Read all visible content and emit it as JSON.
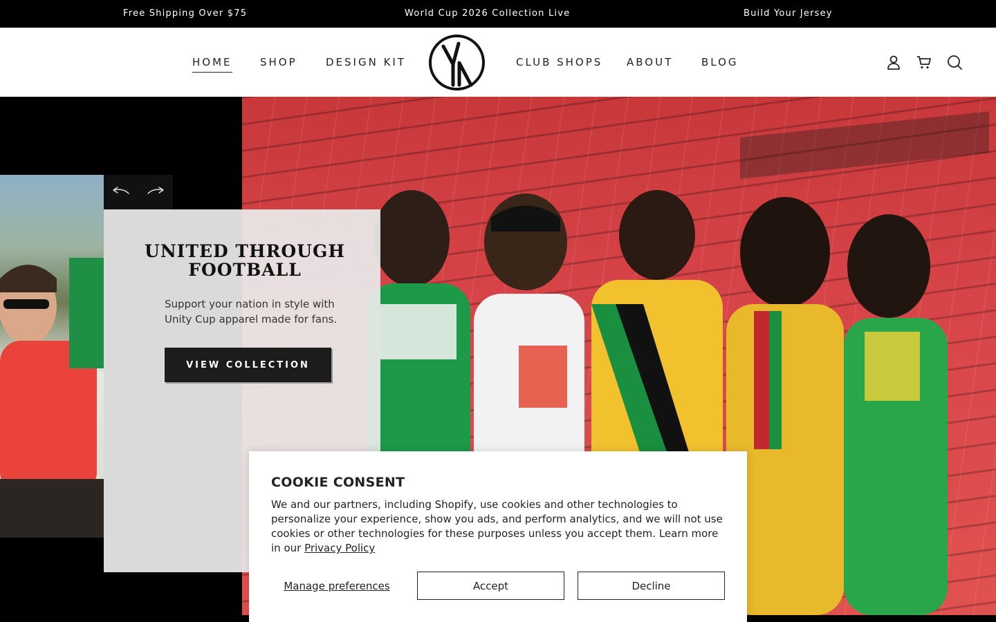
{
  "announcement": {
    "item1": "Free Shipping Over $75",
    "item2": "World Cup 2026 Collection Live",
    "item3": "Build Your Jersey"
  },
  "nav": {
    "home": "HOME",
    "shop": "SHOP",
    "design_kit": "DESIGN KIT",
    "club_shops": "CLUB SHOPS",
    "about": "ABOUT",
    "blog": "BLOG",
    "active": "HOME"
  },
  "header_icons": [
    "account-icon",
    "cart-icon",
    "search-icon"
  ],
  "hero": {
    "title": "UNITED THROUGH FOOTBALL",
    "subtitle": "Support your nation in style with Unity Cup apparel made for fans.",
    "cta": "VIEW COLLECTION",
    "slider_prev_icon": "arrow-left-icon",
    "slider_next_icon": "arrow-right-icon"
  },
  "cookie": {
    "title": "COOKIE CONSENT",
    "text": "We and our partners, including Shopify, use cookies and other technologies to personalize your experience, show you ads, and perform analytics, and we will not use cookies or other technologies for these purposes unless you accept them. Learn more in our ",
    "link": "Privacy Policy",
    "manage": "Manage preferences",
    "accept": "Accept",
    "decline": "Decline"
  },
  "colors": {
    "announcement_bg": "#000000",
    "stadium_red": "#d9464a",
    "card_bg": "#ebebeb",
    "cta_bg": "#1c1c1c"
  }
}
